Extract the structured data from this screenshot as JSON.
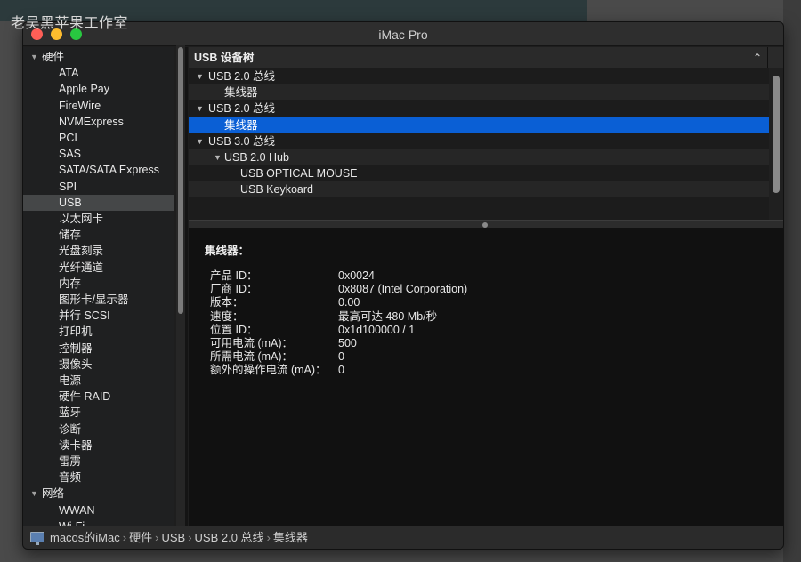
{
  "watermark": "老吴黑苹果工作室",
  "window": {
    "title": "iMac Pro"
  },
  "sidebar": {
    "items": [
      {
        "label": "硬件",
        "category": true
      },
      {
        "label": "ATA"
      },
      {
        "label": "Apple Pay"
      },
      {
        "label": "FireWire"
      },
      {
        "label": "NVMExpress"
      },
      {
        "label": "PCI"
      },
      {
        "label": "SAS"
      },
      {
        "label": "SATA/SATA Express"
      },
      {
        "label": "SPI"
      },
      {
        "label": "USB",
        "selected": true
      },
      {
        "label": "以太网卡"
      },
      {
        "label": "储存"
      },
      {
        "label": "光盘刻录"
      },
      {
        "label": "光纤通道"
      },
      {
        "label": "内存"
      },
      {
        "label": "图形卡/显示器"
      },
      {
        "label": "并行 SCSI"
      },
      {
        "label": "打印机"
      },
      {
        "label": "控制器"
      },
      {
        "label": "摄像头"
      },
      {
        "label": "电源"
      },
      {
        "label": "硬件 RAID"
      },
      {
        "label": "蓝牙"
      },
      {
        "label": "诊断"
      },
      {
        "label": "读卡器"
      },
      {
        "label": "雷雳"
      },
      {
        "label": "音频"
      },
      {
        "label": "网络",
        "category": true
      },
      {
        "label": "WWAN"
      },
      {
        "label": "Wi-Fi"
      }
    ]
  },
  "tree": {
    "header": "USB 设备树",
    "rows": [
      {
        "label": "USB 2.0 总线",
        "level": 0,
        "expanded": true
      },
      {
        "label": "集线器",
        "level": 1
      },
      {
        "label": "USB 2.0 总线",
        "level": 0,
        "expanded": true
      },
      {
        "label": "集线器",
        "level": 1,
        "selected": true
      },
      {
        "label": "USB 3.0 总线",
        "level": 0,
        "expanded": true
      },
      {
        "label": "USB 2.0 Hub",
        "level": 1,
        "expanded": true
      },
      {
        "label": "USB OPTICAL MOUSE",
        "level": 2
      },
      {
        "label": "USB Keykoard",
        "level": 2
      }
    ]
  },
  "detail": {
    "title": "集线器：",
    "rows": [
      {
        "key": "产品 ID：",
        "value": "0x0024"
      },
      {
        "key": "厂商 ID：",
        "value": "0x8087  (Intel Corporation)"
      },
      {
        "key": "版本：",
        "value": "0.00"
      },
      {
        "key": "速度：",
        "value": "最高可达 480 Mb/秒"
      },
      {
        "key": "位置 ID：",
        "value": "0x1d100000 / 1"
      },
      {
        "key": "可用电流 (mA)：",
        "value": "500"
      },
      {
        "key": "所需电流 (mA)：",
        "value": "0"
      },
      {
        "key": "额外的操作电流 (mA)：",
        "value": "0"
      }
    ]
  },
  "pathbar": {
    "crumbs": [
      "macos的iMac",
      "硬件",
      "USB",
      "USB 2.0 总线",
      "集线器"
    ],
    "separator": "›"
  }
}
